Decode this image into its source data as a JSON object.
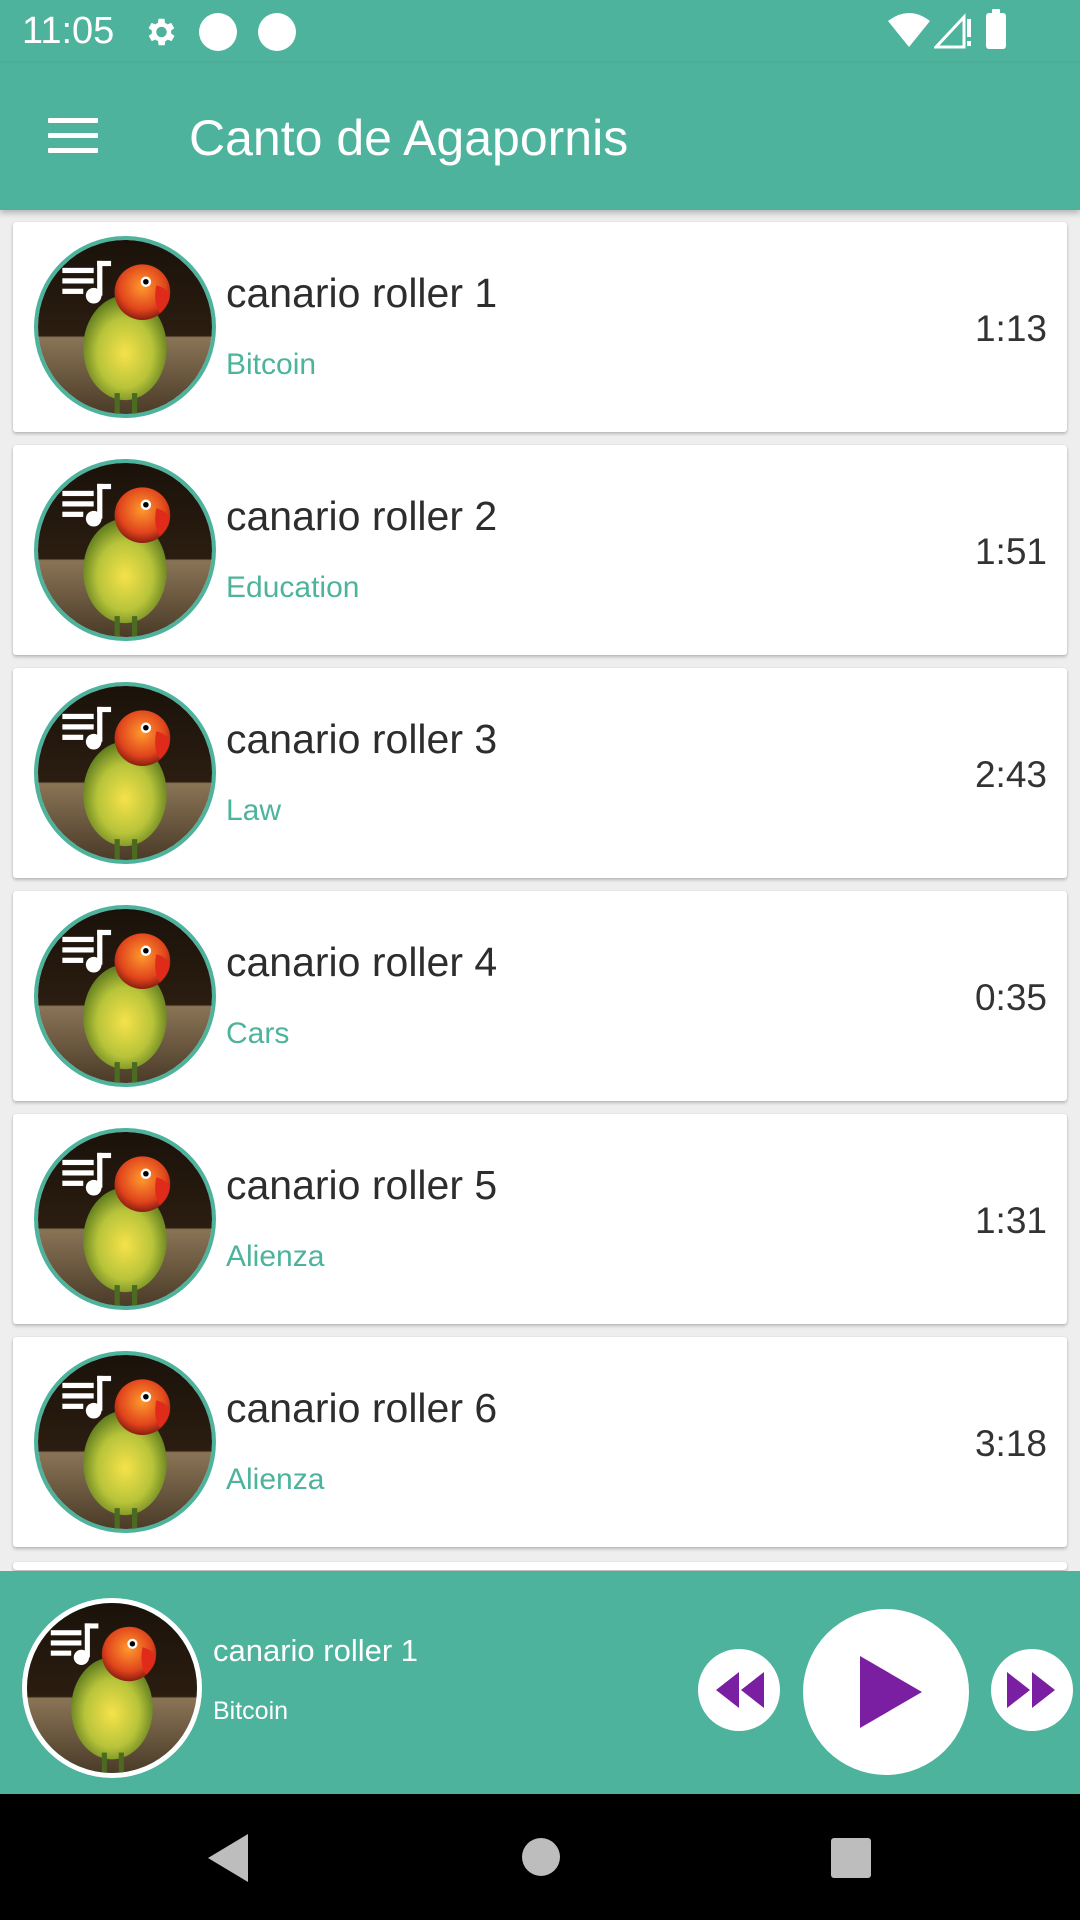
{
  "status_bar": {
    "time": "11:05",
    "icons": [
      "gear-icon",
      "notification-dot-icon",
      "notification-dot-icon",
      "wifi-icon",
      "signal-icon",
      "battery-icon"
    ]
  },
  "app_bar": {
    "title": "Canto de Agapornis",
    "menu_icon": "menu-icon"
  },
  "songs": [
    {
      "title": "canario roller 1",
      "category": "Bitcoin",
      "duration": "1:13"
    },
    {
      "title": "canario roller 2",
      "category": "Education",
      "duration": "1:51"
    },
    {
      "title": "canario roller 3",
      "category": "Law",
      "duration": "2:43"
    },
    {
      "title": "canario roller 4",
      "category": "Cars",
      "duration": "0:35"
    },
    {
      "title": "canario roller 5",
      "category": "Alienza",
      "duration": "1:31"
    },
    {
      "title": "canario roller 6",
      "category": "Alienza",
      "duration": "3:18"
    }
  ],
  "player": {
    "title": "canario roller 1",
    "category": "Bitcoin",
    "controls": [
      "rewind-icon",
      "play-icon",
      "fast-forward-icon"
    ]
  },
  "nav_bar": {
    "buttons": [
      "back-icon",
      "home-icon",
      "recents-icon"
    ]
  },
  "colors": {
    "accent": "#4db39c",
    "control_icon": "#7b1fa2",
    "title_text": "#2d2d2d"
  }
}
